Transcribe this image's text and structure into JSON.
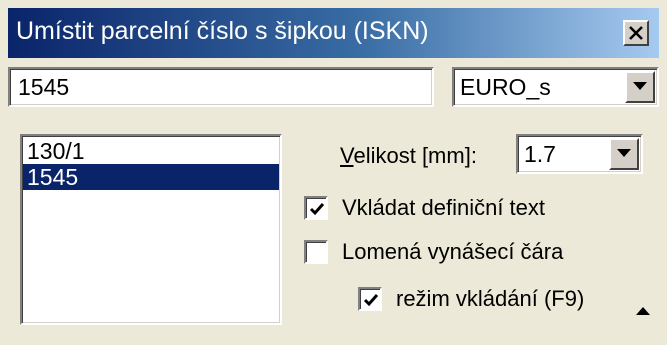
{
  "window": {
    "title": "Umístit parcelní číslo s šipkou (ISKN)"
  },
  "parcel_input": {
    "value": "1545"
  },
  "font_select": {
    "selected": "EURO_s"
  },
  "parcel_list": {
    "items": [
      {
        "label": "130/1",
        "selected": false
      },
      {
        "label": "1545",
        "selected": true
      }
    ]
  },
  "size": {
    "label_accel": "V",
    "label_rest": "elikost [mm]:",
    "selected": "1.7"
  },
  "options": {
    "insert_definition_text": {
      "label": "Vkládat definiční text",
      "checked": true
    },
    "broken_leader_line": {
      "label": "Lomená vynášecí čára",
      "checked": false
    },
    "insert_mode": {
      "label": "režim vkládání (F9)",
      "checked": true
    }
  },
  "colors": {
    "title_gradient_start": "#0a246a",
    "title_gradient_end": "#a6caf0",
    "selection": "#0a246a",
    "face": "#ece9d8"
  },
  "icons": [
    "close-icon",
    "chevron-down-icon",
    "checkmark-icon",
    "expand-up-icon"
  ]
}
